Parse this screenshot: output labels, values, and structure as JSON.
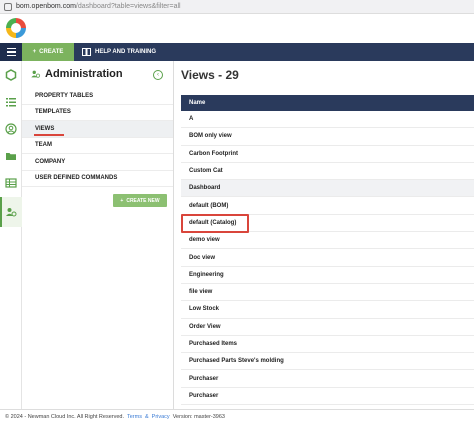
{
  "browser": {
    "url_host": "bom.openbom.com",
    "url_path": "/dashboard?table=views&filter=all"
  },
  "nav": {
    "create_label": "CREATE",
    "help_label": "HELP AND TRAINING"
  },
  "admin": {
    "title": "Administration",
    "items": [
      {
        "label": "PROPERTY TABLES",
        "active": false
      },
      {
        "label": "TEMPLATES",
        "active": false
      },
      {
        "label": "VIEWS",
        "active": true
      },
      {
        "label": "TEAM",
        "active": false
      },
      {
        "label": "COMPANY",
        "active": false
      },
      {
        "label": "USER DEFINED COMMANDS",
        "active": false
      }
    ],
    "create_new_label": "CREATE NEW"
  },
  "main": {
    "title": "Views - 29",
    "column_header": "Name",
    "rows": [
      "A",
      "BOM only view",
      "Carbon Footprint",
      "Custom Cat",
      "Dashboard",
      "default (BOM)",
      "default (Catalog)",
      "demo view",
      "Doc view",
      "Engineering",
      "file view",
      "Low Stock",
      "Order View",
      "Purchased Items",
      "Purchased Parts Steve's molding",
      "Purchaser",
      "Purchaser"
    ],
    "highlighted_row": "Dashboard"
  },
  "footer": {
    "copyright": "© 2024 - Newman Cloud Inc. All Right Reserved.",
    "terms": "Terms",
    "amp": "&",
    "privacy": "Privacy",
    "version": "Version: master-3963"
  },
  "colors": {
    "nav_bg": "#2a3a5c",
    "accent_green": "#7cb35e",
    "highlight_red": "#d9453b"
  }
}
